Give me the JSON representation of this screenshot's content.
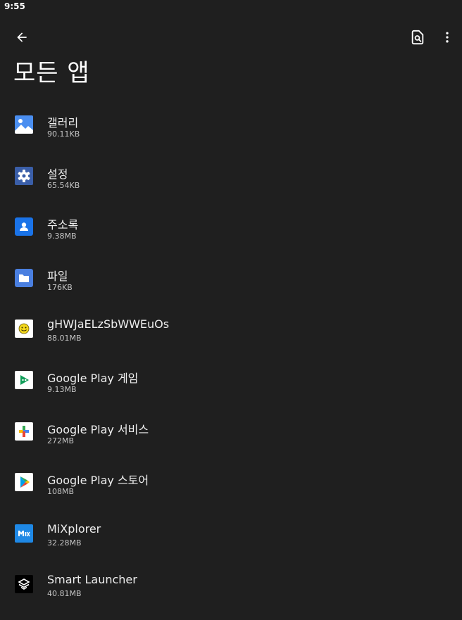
{
  "status_bar": {
    "time": "9:55"
  },
  "toolbar": {
    "back_icon": "arrow-left-icon",
    "search_icon": "page-search-icon",
    "more_icon": "more-vert-icon"
  },
  "page": {
    "title": "모든 앱"
  },
  "apps": [
    {
      "name": "갤러리",
      "size": "90.11KB",
      "icon": "gallery-icon"
    },
    {
      "name": "설정",
      "size": "65.54KB",
      "icon": "settings-icon"
    },
    {
      "name": "주소록",
      "size": "9.38MB",
      "icon": "contacts-icon"
    },
    {
      "name": "파일",
      "size": "176KB",
      "icon": "files-icon"
    },
    {
      "name": "gHWJaELzSbWWEuOs",
      "size": "88.01MB",
      "icon": "smiley-icon"
    },
    {
      "name": "Google Play 게임",
      "size": "9.13MB",
      "icon": "play-games-icon"
    },
    {
      "name": "Google Play 서비스",
      "size": "272MB",
      "icon": "play-services-icon"
    },
    {
      "name": "Google Play 스토어",
      "size": "108MB",
      "icon": "play-store-icon"
    },
    {
      "name": "MiXplorer",
      "size": "32.28MB",
      "icon": "mixplorer-icon"
    },
    {
      "name": "Smart Launcher",
      "size": "40.81MB",
      "icon": "smart-launcher-icon"
    }
  ]
}
